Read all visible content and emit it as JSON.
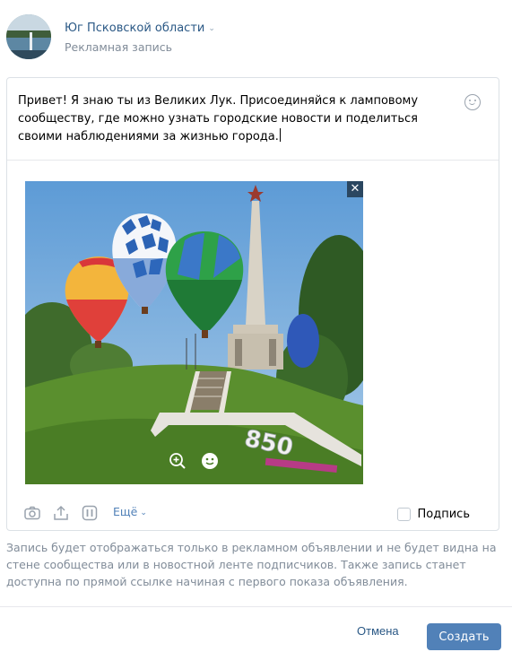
{
  "header": {
    "group_name": "Юг Псковской области",
    "subtitle": "Рекламная запись"
  },
  "post": {
    "text": "Привет! Я знаю ты из Великих Лук. Присоединяйся к ламповому сообществу, где можно узнать городские новости и поделиться своими наблюдениями за жизнью города."
  },
  "photo": {
    "close_glyph": "✕",
    "monument_number": "850"
  },
  "toolbar": {
    "more_label": "Ещё",
    "signature_label": "Подпись",
    "signature_checked": false,
    "icons": [
      "camera-icon",
      "upload-icon",
      "poll-icon"
    ]
  },
  "notice": {
    "text": "Запись будет отображаться только в рекламном объявлении и не будет видна на стене сообщества или в новостной ленте подписчиков. Также запись станет доступна по прямой ссылке начиная с первого показа объявления."
  },
  "footer": {
    "cancel_label": "Отмена",
    "create_label": "Создать"
  },
  "colors": {
    "link": "#2a5885",
    "accent": "#5181b8",
    "muted": "#818c99",
    "border": "#dce1e6"
  }
}
